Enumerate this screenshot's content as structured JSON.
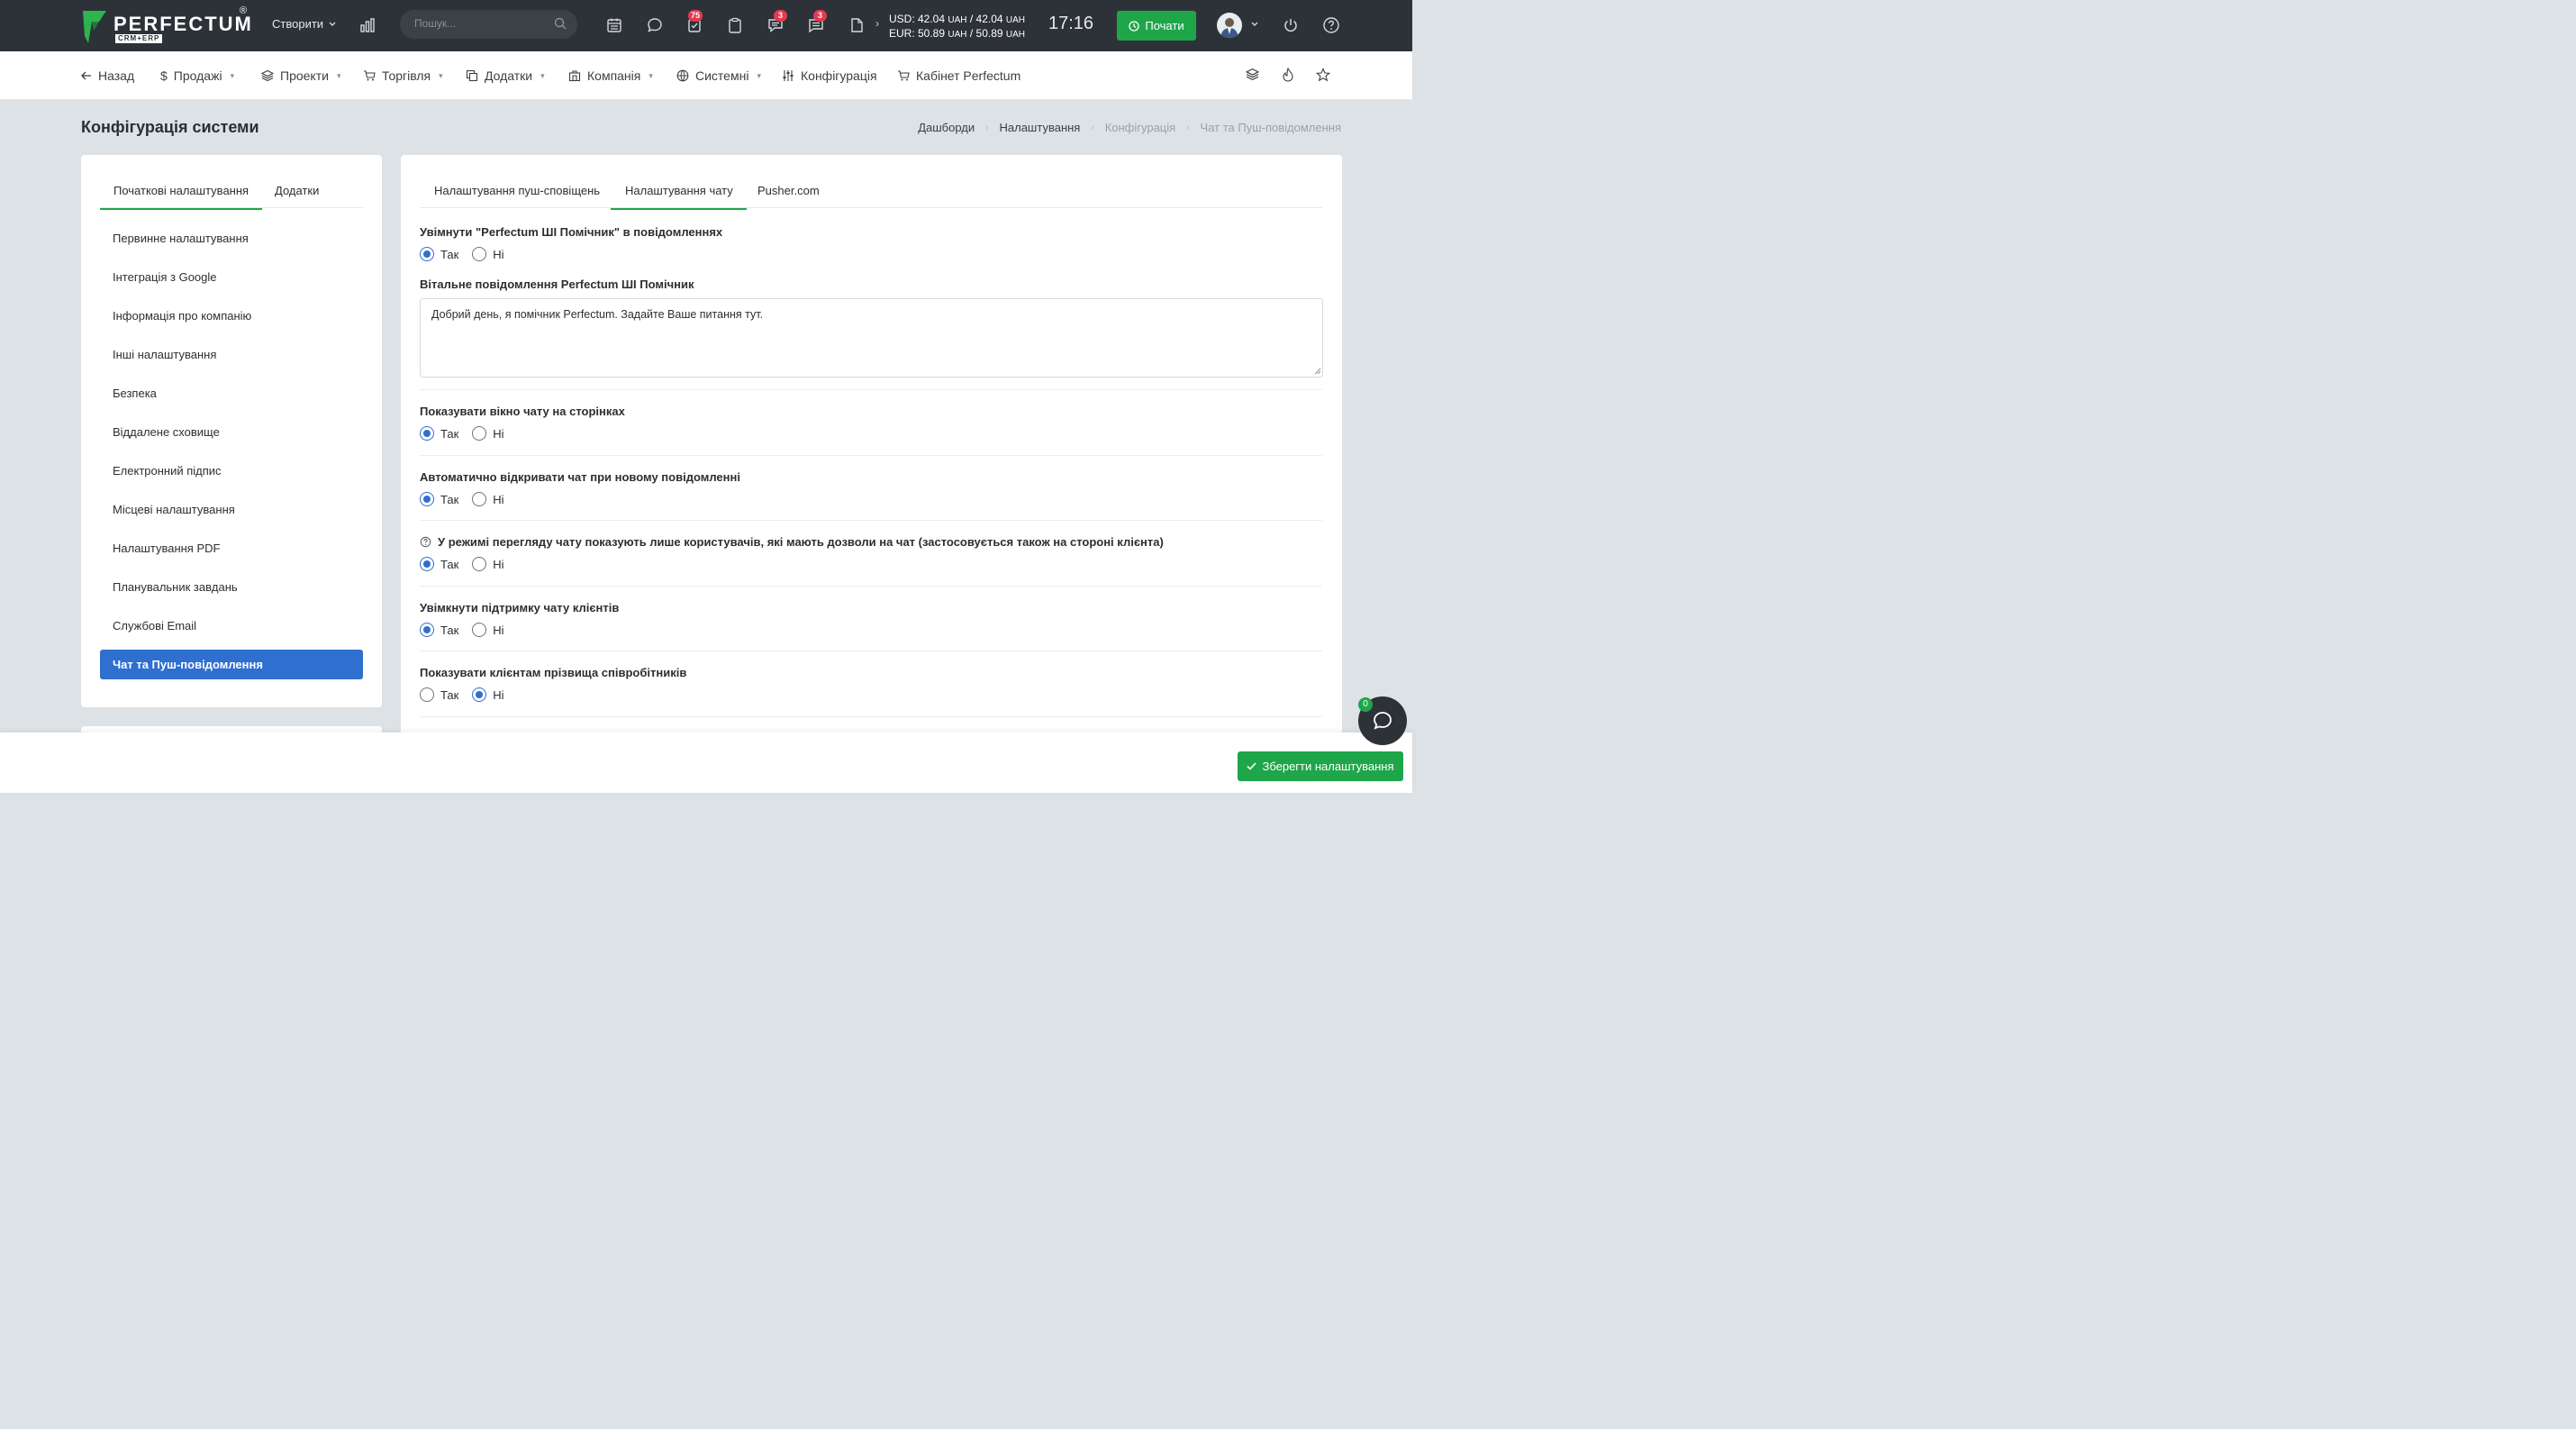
{
  "brand": {
    "name": "PERFECTUM",
    "sub": "CRM+ERP",
    "reg": "®"
  },
  "topbar": {
    "create_label": "Створити",
    "search_placeholder": "Пошук...",
    "badges": {
      "tasks": "75",
      "messages": "3",
      "chat": "3"
    },
    "rates": {
      "usd_label": "USD: 42.04",
      "usd_unit1": "UAH",
      "usd_sep": " / 42.04",
      "usd_unit2": "UAH",
      "eur_label": "EUR: 50.89",
      "eur_unit1": "UAH",
      "eur_sep": " / 50.89",
      "eur_unit2": "UAH"
    },
    "clock": "17:16",
    "start_label": "Почати"
  },
  "nav": {
    "back": "Назад",
    "items": [
      "Продажі",
      "Проекти",
      "Торгівля",
      "Додатки",
      "Компанія",
      "Системні",
      "Конфігурація",
      "Кабінет Perfectum"
    ]
  },
  "page": {
    "title": "Конфігурація системи",
    "breadcrumb": [
      "Дашборди",
      "Налаштування",
      "Конфігурація",
      "Чат та Пуш-повідомлення"
    ]
  },
  "left": {
    "tabs": [
      "Початкові налаштування",
      "Додатки"
    ],
    "menu": [
      "Первинне налаштування",
      "Інтеграція з Google",
      "Інформація про компанію",
      "Інші налаштування",
      "Безпека",
      "Віддалене сховище",
      "Електронний підпис",
      "Місцеві налаштування",
      "Налаштування PDF",
      "Планувальник завдань",
      "Службові Email",
      "Чат та Пуш-повідомлення"
    ]
  },
  "right": {
    "tabs": [
      "Налаштування пуш-сповіщень",
      "Налаштування чату",
      "Pusher.com"
    ],
    "yes": "Так",
    "no": "Ні",
    "fields": {
      "ai_enable": "Увімнути \"Perfectum ШІ Помічник\" в повідомленнях",
      "welcome_label": "Вітальне повідомлення Perfectum ШІ Помічник",
      "welcome_value": "Добрий день, я помічник Perfectum. Задайте Ваше питання тут.",
      "show_window": "Показувати вікно чату на сторінках",
      "auto_open": "Автоматично відкривати чат при новому повідомленні",
      "only_permitted": "У режимі перегляду чату показують лише користувачів, які мають дозволи на чат (застосовується також на стороні клієнта)",
      "client_support": "Увімкнути підтримку чату клієнтів",
      "show_surnames": "Показувати клієнтам прізвища співробітників"
    }
  },
  "footer": {
    "save_label": "Зберегти налаштування",
    "chat_count": "0"
  },
  "colors": {
    "accent_green": "#1fa64a",
    "accent_blue": "#2f6fd0",
    "topbar": "#2d3238"
  }
}
